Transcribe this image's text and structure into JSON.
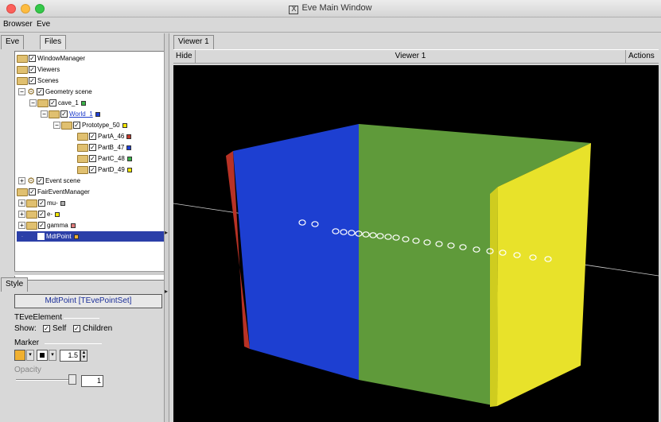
{
  "window": {
    "title": "Eve Main Window",
    "close_color": "#fc605b",
    "minimize_color": "#fdbc40",
    "zoom_color": "#34c84a"
  },
  "menubar": {
    "items": [
      "Browser",
      "Eve"
    ]
  },
  "left_tabs": [
    "Eve",
    "Files"
  ],
  "tree": {
    "items": [
      {
        "label": "WindowManager",
        "checked": true
      },
      {
        "label": "Viewers",
        "checked": true
      },
      {
        "label": "Scenes",
        "checked": true
      },
      {
        "label": "Geometry scene",
        "checked": true
      },
      {
        "label": "cave_1",
        "checked": true,
        "color": "#3bb34a"
      },
      {
        "label": "World_1",
        "checked": true,
        "color": "#1f3fd6"
      },
      {
        "label": "Prototype_50",
        "checked": true,
        "color": "#f2e600"
      },
      {
        "label": "PartA_46",
        "checked": true,
        "color": "#c0392b"
      },
      {
        "label": "PartB_47",
        "checked": true,
        "color": "#1f3fd6"
      },
      {
        "label": "PartC_48",
        "checked": true,
        "color": "#3bb34a"
      },
      {
        "label": "PartD_49",
        "checked": true,
        "color": "#f2e600"
      },
      {
        "label": "Event scene",
        "checked": true
      },
      {
        "label": "FairEventManager",
        "checked": true
      },
      {
        "label": "mu-",
        "checked": true,
        "color": "#b0b0b0"
      },
      {
        "label": "e-",
        "checked": true,
        "color": "#f2e600"
      },
      {
        "label": "gamma",
        "checked": true,
        "color": "#e07b7b"
      },
      {
        "label": "MdtPoint",
        "checked": true,
        "color": "#f0b030",
        "selected": true
      }
    ]
  },
  "style_panel": {
    "tab": "Style",
    "object_button": "MdtPoint [TEvePointSet]",
    "section_element": "TEveElement",
    "show_label": "Show:",
    "self_label": "Self",
    "self_checked": true,
    "children_label": "Children",
    "children_checked": true,
    "marker_label": "Marker",
    "marker_color": "#f0b030",
    "marker_style_color": "#000000",
    "marker_size": "1.5",
    "opacity_label": "Opacity",
    "opacity_value": "1"
  },
  "viewer": {
    "tab": "Viewer 1",
    "hide_button": "Hide",
    "name": "Viewer 1",
    "actions_button": "Actions",
    "colors": {
      "red": "#b83225",
      "blue": "#1d3fd1",
      "green": "#5f9a3a",
      "yellow": "#e8e22a",
      "points": "#ffffff"
    }
  }
}
